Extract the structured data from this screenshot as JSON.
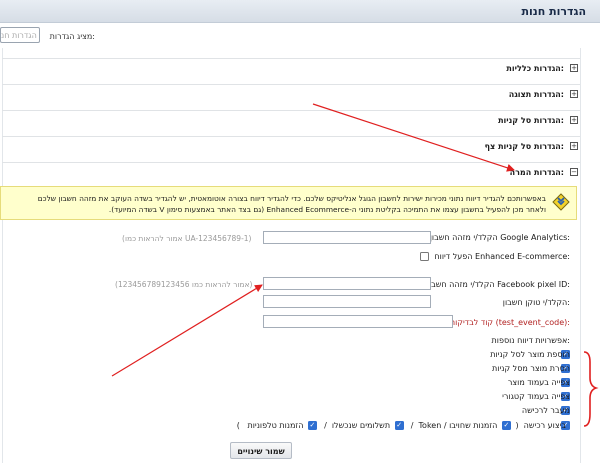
{
  "page": {
    "title": "הגדרות חנות",
    "store_settings_display_label": "מציג הגדרות:",
    "store_settings_selector_value": "הגדרות חנ"
  },
  "sections": [
    {
      "label": "הגדרות כלליות:",
      "toggle": "+"
    },
    {
      "label": "הגדרות תצוגה:",
      "toggle": "+"
    },
    {
      "label": "הגדרות סל קניות:",
      "toggle": "+"
    },
    {
      "label": "הגדרות סל קניות צף:",
      "toggle": "+"
    },
    {
      "label": "הגדרות המרה:",
      "toggle": "−"
    }
  ],
  "notice": {
    "line1": "באפשרותכם להגדיר דיווח נתוני מכירות ישירות לחשבון הגוגל אנליטיקס שלכם. כדי להגדיר דיווח בצורה אוטומאטית, יש להגדיר בשדה העוקב את מזהה חשבון שלכם",
    "line2": "ולאחר מכן להפעיל בחשבון עצמו את התמיכה בקליטת נתוני ה-Enhanced Ecommerce (גם בצד האתר באמצעות סימון V בשדה המיועד)."
  },
  "form": {
    "ga_label": "הקלד/י מזהה חשבון Google Analytics:",
    "ga_hint": "(אמור להראות כמו UA-123456789-1)",
    "ga_value": "",
    "ecommerce_label": "הפעל דיווח Enhanced E-commerce:",
    "ecommerce_checked": false,
    "fb_pixel_label": "הקלד/י מזהה חשבון Facebook pixel ID:",
    "fb_pixel_hint": "(אמור להראות כמו 123456789123456)",
    "fb_pixel_value": "",
    "token_label": "הקלד/י טוקן חשבון:",
    "token_value": "",
    "test_code_label": "קוד לבדיקות (test_event_code):",
    "test_code_value": "",
    "extra_options_label": "אפשרויות דיווח נוספות:"
  },
  "options": [
    {
      "label": "הוספת מוצר לסל קניות",
      "checked": true
    },
    {
      "label": "הסרת מוצר מסל קניות",
      "checked": true
    },
    {
      "label": "צפייה בעמוד מוצר",
      "checked": true
    },
    {
      "label": "צפייה בעמוד קטגורי",
      "checked": true
    },
    {
      "label": "מעבר לרכישה",
      "checked": true
    }
  ],
  "purchase_row": {
    "purchase_label": "ביצוע רכישה",
    "open_paren": "(",
    "token_orders_label": "הזמנות שחויבו / Token",
    "separator1": "/",
    "paid_label": "תשלומים שנכשלו",
    "separator2": "/",
    "phone_orders_label": "הזמנות טלפוניות",
    "close_paren": ")"
  },
  "actions": {
    "save_label": "שמור שינויים"
  },
  "colors": {
    "checkbox_blue": "#2f6fd1",
    "annotation_red": "#e02020",
    "notice_bg": "#ffffcc"
  }
}
